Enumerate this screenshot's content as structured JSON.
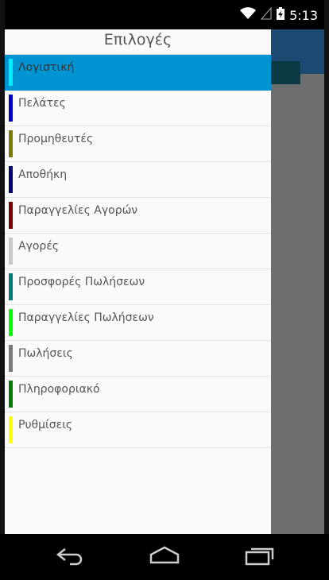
{
  "status_bar": {
    "time": "5:13"
  },
  "drawer": {
    "title": "Επιλογές",
    "items": [
      {
        "label": "Λογιστική",
        "color": "#00f0ff",
        "active": true
      },
      {
        "label": "Πελάτες",
        "color": "#0000cc"
      },
      {
        "label": "Προμηθευτές",
        "color": "#7a7a00"
      },
      {
        "label": "Αποθήκη",
        "color": "#00006e"
      },
      {
        "label": "Παραγγελίες Αγορών",
        "color": "#7a0000"
      },
      {
        "label": "Αγορές",
        "color": "#c8c8c8"
      },
      {
        "label": "Προσφορές Πωλήσεων",
        "color": "#007a7a"
      },
      {
        "label": "Παραγγελίες Πωλήσεων",
        "color": "#00ff00"
      },
      {
        "label": "Πωλήσεις",
        "color": "#7a7a7a"
      },
      {
        "label": "Πληροφοριακό",
        "color": "#007a00"
      },
      {
        "label": "Ρυθμίσεις",
        "color": "#ffff00"
      }
    ]
  },
  "nav_bar": {
    "buttons": [
      "back-icon",
      "home-icon",
      "recents-icon"
    ]
  },
  "colors": {
    "accent": "#0094d3",
    "app_header": "#1d4a72"
  }
}
